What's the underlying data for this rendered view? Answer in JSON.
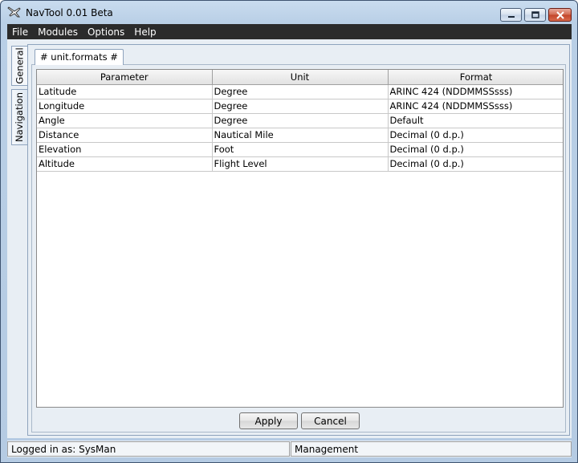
{
  "window": {
    "title": "NavTool 0.01 Beta"
  },
  "menu": {
    "items": [
      "File",
      "Modules",
      "Options",
      "Help"
    ]
  },
  "side_tabs": {
    "general": "General",
    "navigation": "Navigation"
  },
  "inner_tab": {
    "label": "# unit.formats #"
  },
  "table": {
    "headers": [
      "Parameter",
      "Unit",
      "Format"
    ],
    "rows": [
      [
        "Latitude",
        "Degree",
        "ARINC 424 (NDDMMSSsss)"
      ],
      [
        "Longitude",
        "Degree",
        "ARINC 424 (NDDMMSSsss)"
      ],
      [
        "Angle",
        "Degree",
        "Default"
      ],
      [
        "Distance",
        "Nautical Mile",
        "Decimal (0 d.p.)"
      ],
      [
        "Elevation",
        "Foot",
        "Decimal (0 d.p.)"
      ],
      [
        "Altitude",
        "Flight Level",
        "Decimal (0 d.p.)"
      ]
    ]
  },
  "buttons": {
    "apply": "Apply",
    "cancel": "Cancel"
  },
  "status": {
    "user": "Logged in as: SysMan",
    "module": "Management"
  }
}
